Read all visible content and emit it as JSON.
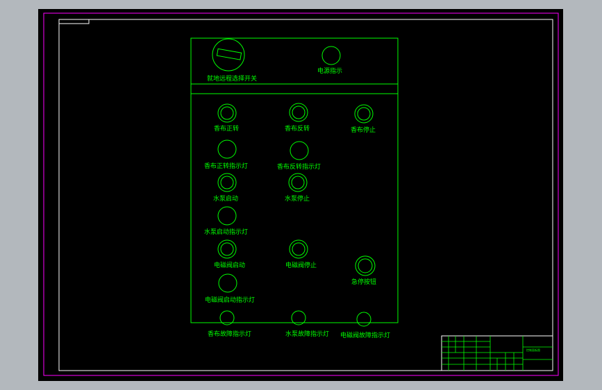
{
  "colors": {
    "viewport_bg": "#000000",
    "outer_border": "#ff00ff",
    "frame": "#ffffff",
    "lines": "#00ff00",
    "app_bg": "#b3b8bd"
  },
  "panel": {
    "top_section": {
      "selector_switch_label": "就地远程选择开关",
      "power_indicator_label": "电源指示"
    },
    "controls": [
      {
        "id": "pump-fwd",
        "label": "香布正转"
      },
      {
        "id": "pump-rev",
        "label": "香布反转"
      },
      {
        "id": "pump-stop",
        "label": "香布停止"
      },
      {
        "id": "pump-fwd-lamp",
        "label": "香布正转指示灯"
      },
      {
        "id": "pump-rev-lamp",
        "label": "香布反转指示灯"
      },
      {
        "id": "water-start",
        "label": "水泵启动"
      },
      {
        "id": "water-stop",
        "label": "水泵停止"
      },
      {
        "id": "water-start-lamp",
        "label": "水泵启动指示灯"
      },
      {
        "id": "valve-start",
        "label": "电磁阀启动"
      },
      {
        "id": "valve-stop",
        "label": "电磁阀停止"
      },
      {
        "id": "estop",
        "label": "急停按钮"
      },
      {
        "id": "valve-start-lamp",
        "label": "电磁阀启动指示灯"
      },
      {
        "id": "pump-fault-lamp",
        "label": "香布故障指示灯"
      },
      {
        "id": "water-fault-lamp",
        "label": "水泵故障指示灯"
      },
      {
        "id": "valve-fault-lamp",
        "label": "电磁阀故障指示灯"
      }
    ]
  },
  "title_block": {
    "heading": "控制面板图"
  }
}
